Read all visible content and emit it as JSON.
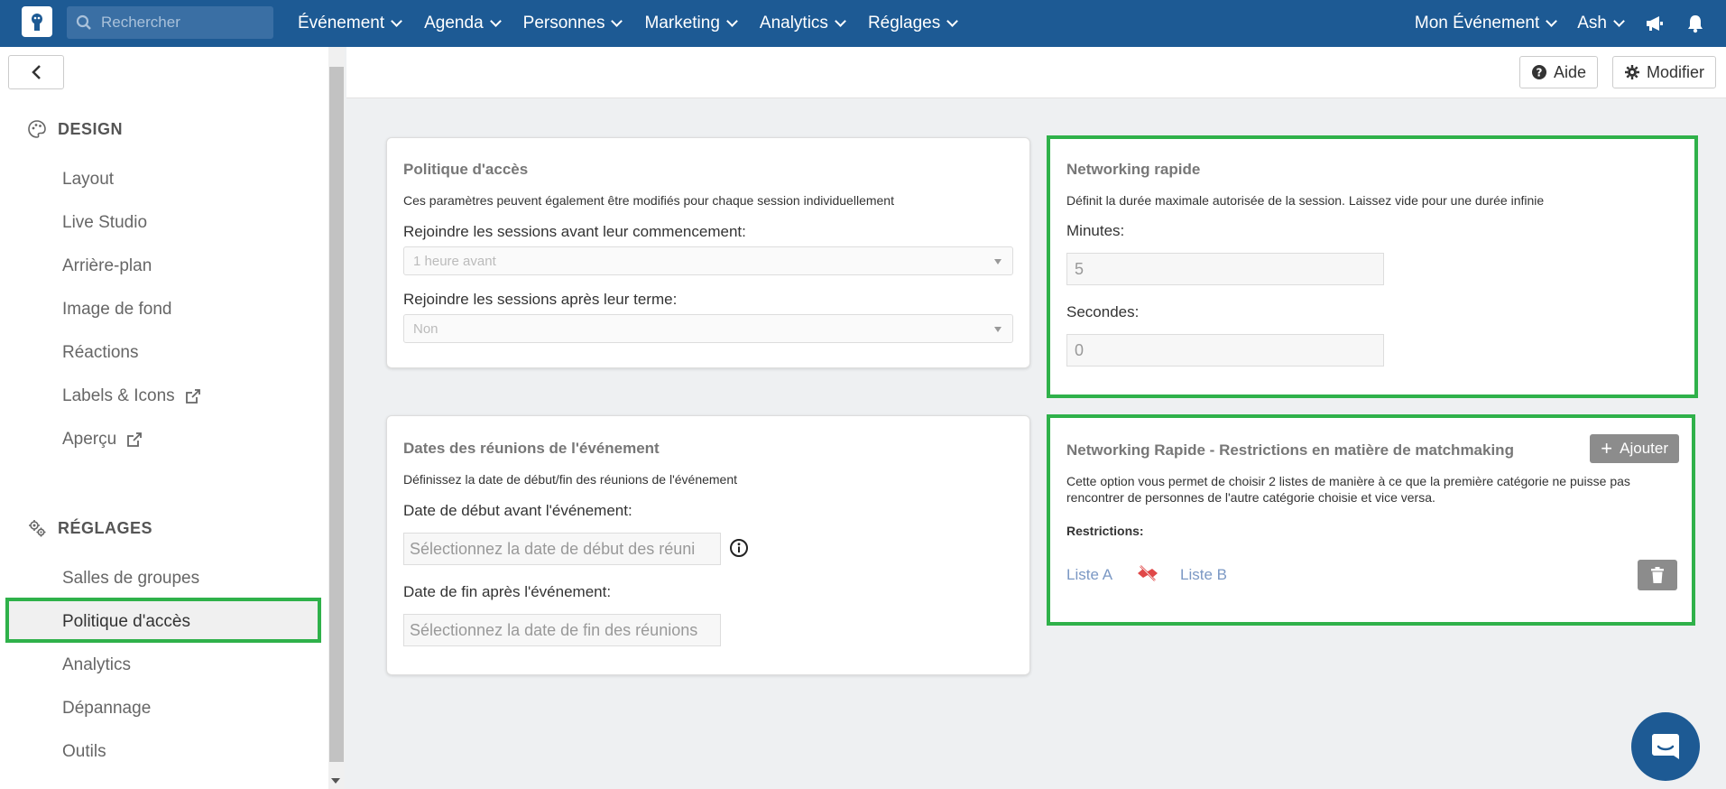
{
  "topbar": {
    "search_placeholder": "Rechercher",
    "nav": [
      "Événement",
      "Agenda",
      "Personnes",
      "Marketing",
      "Analytics",
      "Réglages"
    ],
    "event_selector": "Mon Événement",
    "user": "Ash"
  },
  "header": {
    "help_label": "Aide",
    "edit_label": "Modifier"
  },
  "sidebar": {
    "design_title": "DESIGN",
    "design_items": [
      "Layout",
      "Live Studio",
      "Arrière-plan",
      "Image de fond",
      "Réactions",
      "Labels & Icons",
      "Aperçu"
    ],
    "settings_title": "RÉGLAGES",
    "settings_items": [
      "Salles de groupes",
      "Politique d'accès",
      "Analytics",
      "Dépannage",
      "Outils"
    ],
    "active_item": "Politique d'accès"
  },
  "access_policy": {
    "title": "Politique d'accès",
    "description": "Ces paramètres peuvent également être modifiés pour chaque session individuellement",
    "join_before_label": "Rejoindre les sessions avant leur commencement:",
    "join_before_value": "1 heure avant",
    "join_after_label": "Rejoindre les sessions après leur terme:",
    "join_after_value": "Non"
  },
  "meeting_dates": {
    "title": "Dates des réunions de l'événement",
    "description": "Définissez la date de début/fin des réunions de l'événement",
    "start_label": "Date de début avant l'événement:",
    "start_placeholder": "Sélectionnez la date de début des réuni",
    "end_label": "Date de fin après l'événement:",
    "end_placeholder": "Sélectionnez la date de fin des réunions"
  },
  "speed_networking": {
    "title": "Networking rapide",
    "description": "Définit la durée maximale autorisée de la session. Laissez vide pour une durée infinie",
    "minutes_label": "Minutes:",
    "minutes_value": "5",
    "seconds_label": "Secondes:",
    "seconds_value": "0"
  },
  "restrictions": {
    "title": "Networking Rapide - Restrictions en matière de matchmaking",
    "add_label": "Ajouter",
    "description_line1": "Cette option vous permet de choisir 2 listes de manière à ce que la première catégorie ne puisse pas",
    "description_line2": "rencontrer de personnes de l'autre catégorie choisie et vice versa.",
    "restrictions_label": "Restrictions:",
    "list_a": "Liste A",
    "list_b": "Liste B"
  },
  "colors": {
    "topbar": "#1d5a94",
    "highlight": "#2fb14a",
    "link": "#7b98c4",
    "danger_icon": "#e04848"
  }
}
